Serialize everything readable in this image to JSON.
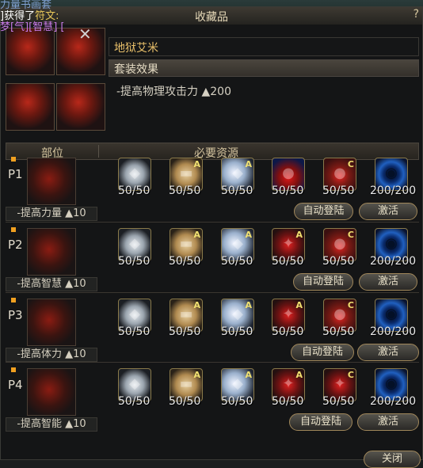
{
  "chat": {
    "line1": "力量书画套",
    "line2_prefix": "]获得了",
    "line2_gold": "符文:",
    "line3": "梦[气][智慧] ["
  },
  "window": {
    "title": "收藏品",
    "help": "?",
    "close_glyph": "✕"
  },
  "set_info": {
    "name": "地狱艾米",
    "section_label": "套装效果",
    "effect": "-提高物理攻击力 ▲200"
  },
  "table_header": {
    "col_part": "部位",
    "col_resources": "必要资源"
  },
  "rows": [
    {
      "label": "P1",
      "effect": "-提高力量 ▲10",
      "resources": [
        {
          "icon": "ore-icon",
          "type": "ore",
          "grade": "",
          "count": "50/50"
        },
        {
          "icon": "parchment-icon",
          "type": "paper",
          "grade": "A",
          "count": "50/50"
        },
        {
          "icon": "crystal-icon",
          "type": "crystal",
          "grade": "A",
          "count": "50/50"
        },
        {
          "icon": "potion-icon",
          "type": "potion",
          "grade": "",
          "count": "50/50"
        },
        {
          "icon": "bottle-icon",
          "type": "bottle",
          "grade": "C",
          "count": "50/50"
        },
        {
          "icon": "vortex-icon",
          "type": "vortex",
          "grade": "",
          "count": "200/200"
        }
      ],
      "auto_label": "自动登陆",
      "activate_label": "激活"
    },
    {
      "label": "P2",
      "effect": "-提高智慧 ▲10",
      "resources": [
        {
          "icon": "ore-icon",
          "type": "ore",
          "grade": "",
          "count": "50/50"
        },
        {
          "icon": "parchment-icon",
          "type": "paper",
          "grade": "A",
          "count": "50/50"
        },
        {
          "icon": "crystal-icon",
          "type": "crystal",
          "grade": "A",
          "count": "50/50"
        },
        {
          "icon": "dagger-icon",
          "type": "dagger",
          "grade": "A",
          "count": "50/50"
        },
        {
          "icon": "bottle-icon",
          "type": "bottle",
          "grade": "C",
          "count": "50/50"
        },
        {
          "icon": "vortex-icon",
          "type": "vortex",
          "grade": "",
          "count": "200/200"
        }
      ],
      "auto_label": "自动登陆",
      "activate_label": "激活"
    },
    {
      "label": "P3",
      "effect": "-提高体力 ▲10",
      "resources": [
        {
          "icon": "ore-icon",
          "type": "ore",
          "grade": "",
          "count": "50/50"
        },
        {
          "icon": "parchment-icon",
          "type": "paper",
          "grade": "A",
          "count": "50/50"
        },
        {
          "icon": "crystal-icon",
          "type": "crystal",
          "grade": "A",
          "count": "50/50"
        },
        {
          "icon": "dagger-icon",
          "type": "dagger",
          "grade": "A",
          "count": "50/50"
        },
        {
          "icon": "bottle-icon",
          "type": "bottle",
          "grade": "C",
          "count": "50/50"
        },
        {
          "icon": "vortex-icon",
          "type": "vortex",
          "grade": "",
          "count": "200/200"
        }
      ],
      "auto_label": "自动登陆",
      "activate_label": "激活"
    },
    {
      "label": "P4",
      "effect": "-提高智能 ▲10",
      "resources": [
        {
          "icon": "ore-icon",
          "type": "ore",
          "grade": "",
          "count": "50/50"
        },
        {
          "icon": "parchment-icon",
          "type": "paper",
          "grade": "A",
          "count": "50/50"
        },
        {
          "icon": "crystal-icon",
          "type": "crystal",
          "grade": "A",
          "count": "50/50"
        },
        {
          "icon": "dagger-icon",
          "type": "dagger",
          "grade": "A",
          "count": "50/50"
        },
        {
          "icon": "dagger-icon",
          "type": "dagger",
          "grade": "C",
          "count": "50/50"
        },
        {
          "icon": "vortex-icon",
          "type": "vortex",
          "grade": "",
          "count": "200/200"
        }
      ],
      "auto_label": "自动登陆",
      "activate_label": "激活"
    }
  ],
  "footer": {
    "close_label": "关闭"
  }
}
